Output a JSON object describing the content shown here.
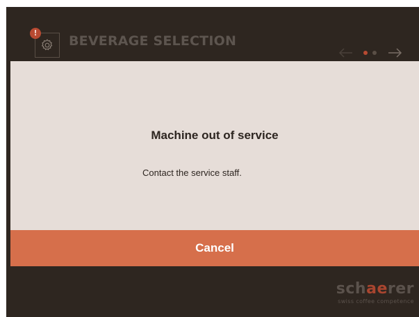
{
  "header": {
    "title": "BEVERAGE SELECTION",
    "settings_icon": "gear-icon",
    "alert_badge": "!",
    "pager": {
      "prev_icon": "arrow-left-icon",
      "next_icon": "arrow-right-icon",
      "page_count": 2,
      "active_page": 1
    }
  },
  "dialog": {
    "title": "Machine out of service",
    "message": "Contact the service staff.",
    "cancel_label": "Cancel"
  },
  "brand": {
    "name_part1": "sch",
    "name_accent": "ae",
    "name_part2": "rer",
    "tagline": "swiss coffee competence"
  },
  "colors": {
    "background": "#2e2620",
    "dialog": "#e6ddd8",
    "accent": "#d66f4b",
    "badge": "#b84a32",
    "active_dot": "#b84a32",
    "inactive_dot": "#5a4f46"
  }
}
